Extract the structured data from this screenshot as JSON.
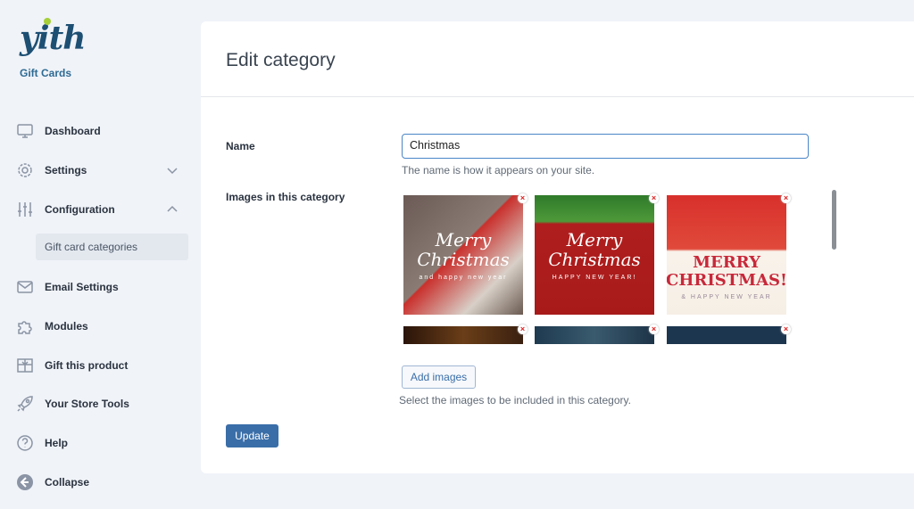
{
  "sidebar": {
    "logo": "yith",
    "brand": "Gift Cards",
    "items": [
      {
        "label": "Dashboard",
        "icon": "monitor-icon"
      },
      {
        "label": "Settings",
        "icon": "gear-icon"
      },
      {
        "label": "Configuration",
        "icon": "sliders-icon"
      },
      {
        "label": "Email Settings",
        "icon": "envelope-icon"
      },
      {
        "label": "Modules",
        "icon": "puzzle-icon"
      },
      {
        "label": "Gift this product",
        "icon": "gift-icon"
      },
      {
        "label": "Your Store Tools",
        "icon": "rocket-icon"
      },
      {
        "label": "Help",
        "icon": "help-icon"
      },
      {
        "label": "Collapse",
        "icon": "collapse-icon"
      }
    ],
    "subitem": "Gift card categories"
  },
  "main": {
    "title": "Edit category",
    "name_label": "Name",
    "name_value": "Christmas",
    "name_desc": "The name is how it appears on your site.",
    "images_label": "Images in this category",
    "images": [
      {
        "text": "Merry Christmas",
        "sub": "and happy new year"
      },
      {
        "text": "Merry Christmas",
        "sub": "HAPPY NEW YEAR!"
      },
      {
        "text": "MERRY CHRISTMAS!",
        "sub": "& HAPPY NEW YEAR"
      },
      {
        "text": "",
        "sub": ""
      },
      {
        "text": "",
        "sub": ""
      },
      {
        "text": "",
        "sub": ""
      }
    ],
    "remove_glyph": "×",
    "add_images": "Add images",
    "images_desc": "Select the images to be included in this category.",
    "update": "Update"
  },
  "colors": {
    "accent": "#3a6ea8",
    "focus": "#4a86c8",
    "remove": "#e02020"
  }
}
